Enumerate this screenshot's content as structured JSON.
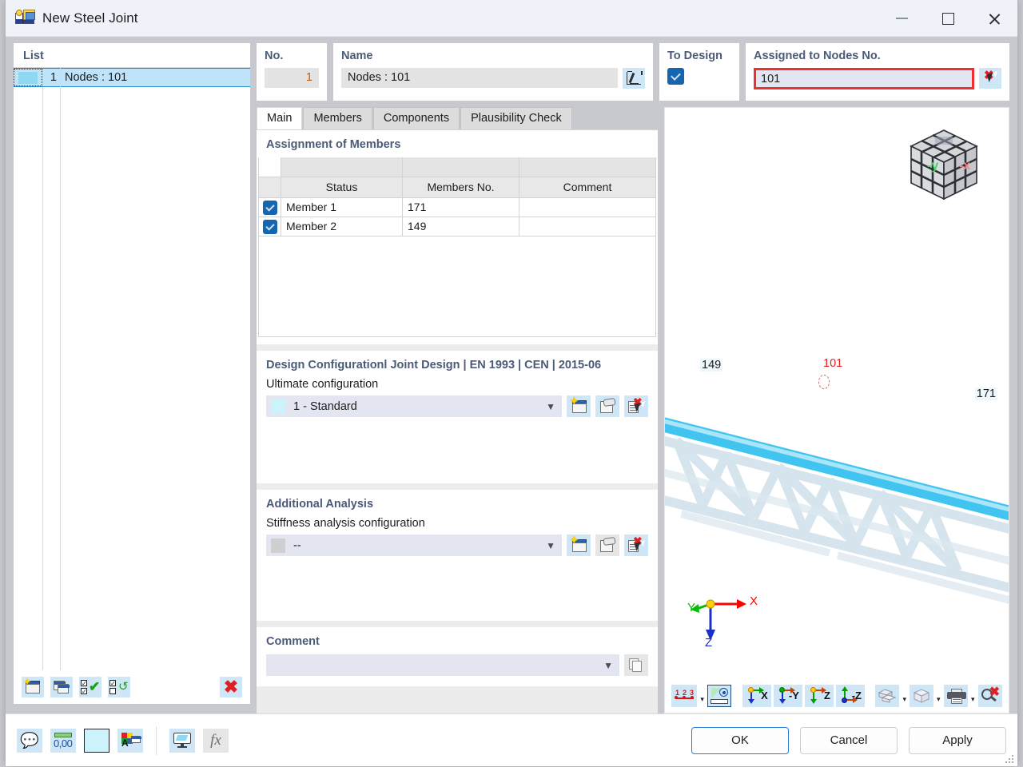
{
  "window": {
    "title": "New Steel Joint",
    "icon": "steel-joint-icon",
    "minimize_label": "–",
    "maximize_label": "☐",
    "close_label": "✕"
  },
  "list_panel": {
    "title": "List",
    "rows": [
      {
        "number": "1",
        "label": "Nodes : 101",
        "color": "#8fd8f2"
      }
    ],
    "toolbar": [
      {
        "name": "new-joint-button",
        "tooltip": "New"
      },
      {
        "name": "copy-joint-button",
        "tooltip": "Copy"
      },
      {
        "name": "select-all-button",
        "tooltip": "Select All"
      },
      {
        "name": "invert-selection-button",
        "tooltip": "Invert Selection"
      },
      {
        "name": "delete-joint-button",
        "tooltip": "Delete"
      }
    ]
  },
  "fields": {
    "no_label": "No.",
    "no_value": "1",
    "name_label": "Name",
    "name_value": "Nodes : 101",
    "name_edit_icon": "pencil-edit-icon",
    "to_design_label": "To Design",
    "to_design_checked": true,
    "assigned_label": "Assigned to Nodes No.",
    "assigned_value": "101",
    "assigned_pick_icon": "pick-deselect-icon",
    "assigned_highlight_color": "#ef3030"
  },
  "tabs": [
    {
      "label": "Main",
      "active": true
    },
    {
      "label": "Members",
      "active": false
    },
    {
      "label": "Components",
      "active": false
    },
    {
      "label": "Plausibility Check",
      "active": false
    }
  ],
  "assignment": {
    "title": "Assignment of Members",
    "columns": [
      "",
      "Status",
      "Members No.",
      "Comment"
    ],
    "rows": [
      {
        "checked": true,
        "status": "Member 1",
        "members_no": "171",
        "comment": ""
      },
      {
        "checked": true,
        "status": "Member 2",
        "members_no": "149",
        "comment": ""
      }
    ]
  },
  "design_configuration": {
    "title": "Design Configurationl Joint Design | EN 1993 | CEN | 2015-06",
    "field_label": "Ultimate configuration",
    "value": "1 - Standard",
    "swatch_color": "#ccf3fb",
    "buttons": [
      {
        "name": "new-configuration-button"
      },
      {
        "name": "edit-configuration-button"
      },
      {
        "name": "delete-configuration-button"
      }
    ]
  },
  "additional_analysis": {
    "title": "Additional Analysis",
    "field_label": "Stiffness analysis configuration",
    "value": "--",
    "swatch_color": "#cfcfcf",
    "buttons": [
      {
        "name": "new-stiffness-configuration-button"
      },
      {
        "name": "edit-stiffness-configuration-button",
        "disabled": true
      },
      {
        "name": "delete-stiffness-configuration-button"
      }
    ]
  },
  "comment": {
    "title": "Comment",
    "value": "",
    "copy_icon": "copy-comment-icon"
  },
  "viewport": {
    "view_cube": {
      "face_y": "-y",
      "face_x": "-x",
      "color_y": "#4fd06a",
      "color_x": "#f08a8a"
    },
    "axis_triad": {
      "x": "X",
      "y": "Y",
      "z": "Z",
      "x_color": "#ff0000",
      "y_color": "#00c000",
      "z_color": "#1a31c8"
    },
    "model_labels": [
      {
        "text": "149",
        "color": "#1c1d1f"
      },
      {
        "text": "101",
        "color": "#e02020"
      },
      {
        "text": "171",
        "color": "#1c1d1f"
      }
    ],
    "member_color": "#56cdf5",
    "toolbar": [
      {
        "name": "numbering-toolbar-button",
        "label": "1 2 3"
      },
      {
        "name": "render-view-button",
        "selected": true
      },
      {
        "name": "view-in-x-button",
        "label": "X"
      },
      {
        "name": "view-in-negative-y-button",
        "label": "-Y"
      },
      {
        "name": "view-in-z-button",
        "label": "Z"
      },
      {
        "name": "view-in-negative-z-button",
        "label": "-Z"
      },
      {
        "name": "display-mode-button"
      },
      {
        "name": "wireframe-button"
      },
      {
        "name": "print-button"
      },
      {
        "name": "zoom-reset-button"
      }
    ]
  },
  "footer": {
    "tools": [
      {
        "name": "help-button",
        "icon": "help-balloon-icon"
      },
      {
        "name": "units-button",
        "icon": "units-decimal-icon",
        "label": "0,00"
      },
      {
        "name": "color-swatch-button",
        "icon": "color-swatch-icon",
        "color": "#ccf3fb"
      },
      {
        "name": "display-properties-button",
        "icon": "abc-colors-icon"
      },
      {
        "name": "graphic-print-button",
        "icon": "screen-print-icon"
      },
      {
        "name": "formula-button",
        "icon": "fx-icon",
        "label": "fx",
        "disabled": true
      }
    ],
    "buttons": [
      {
        "name": "ok-button",
        "label": "OK",
        "primary": true
      },
      {
        "name": "cancel-button",
        "label": "Cancel",
        "primary": false
      },
      {
        "name": "apply-button",
        "label": "Apply",
        "primary": false
      }
    ]
  }
}
